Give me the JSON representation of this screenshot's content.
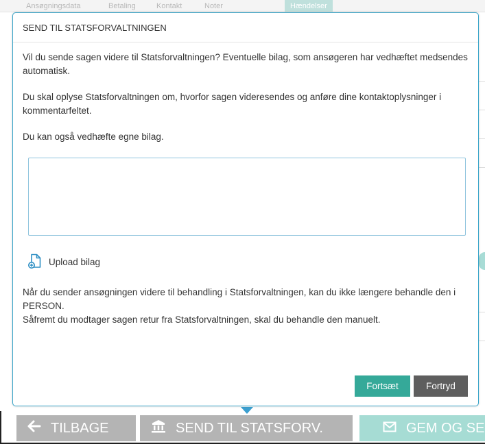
{
  "background": {
    "tabs": [
      {
        "label": "Ansøgningsdata"
      },
      {
        "label": "Betaling"
      },
      {
        "label": "Kontakt"
      },
      {
        "label": "Noter"
      },
      {
        "label": "Hændelser"
      }
    ]
  },
  "modal": {
    "title": "SEND TIL STATSFORVALTNINGEN",
    "paragraph_1": "Vil du sende sagen videre til Statsforvaltningen? Eventuelle bilag, som ansøgeren har vedhæftet medsendes automatisk.",
    "paragraph_2": "Du skal oplyse Statsforvaltningen om, hvorfor sagen videresendes og anføre dine kontaktoplysninger i kommentarfeltet.",
    "paragraph_3": "Du kan også vedhæfte egne bilag.",
    "comment_value": "",
    "upload_label": "Upload bilag",
    "notice_line_1": "Når du sender ansøgningen videre til behandling i Statsforvaltningen, kan du ikke længere behandle den i PERSON.",
    "notice_line_2": "Såfremt du modtager sagen retur fra Statsforvaltningen, skal du behandle den manuelt.",
    "continue_label": "Fortsæt",
    "cancel_label": "Fortryd"
  },
  "bottom_bar": {
    "back_label": "TILBAGE",
    "back_icon": "arrow-left-icon",
    "send_label": "SEND TIL STATSFORV.",
    "send_icon": "bank-icon",
    "save_label": "GEM OG SEND",
    "save_icon": "envelope-icon"
  },
  "colors": {
    "accent_teal": "#35a999",
    "modal_border": "#3aa5c9",
    "cancel_grey": "#5e5e5e",
    "bar_grey": "#b4b4b4",
    "bar_teal_disabled": "#a6dcd4"
  }
}
